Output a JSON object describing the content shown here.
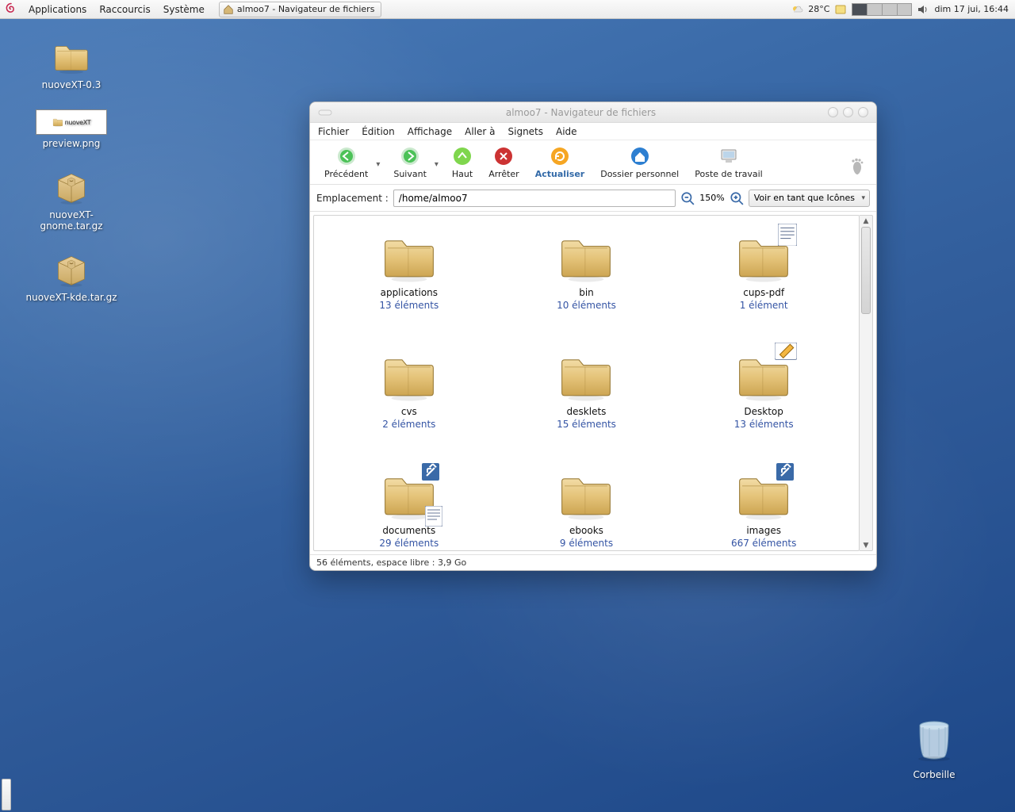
{
  "panel": {
    "menus": [
      "Applications",
      "Raccourcis",
      "Système"
    ],
    "taskbar_label": "almoo7 - Navigateur de fichiers",
    "weather": "28°C",
    "clock": "dim 17 jui, 16:44"
  },
  "desktop_icons": [
    {
      "name": "nuoveXT-0.3",
      "type": "folder"
    },
    {
      "name": "preview.png",
      "type": "image"
    },
    {
      "name": "nuoveXT-gnome.tar.gz",
      "type": "package"
    },
    {
      "name": "nuoveXT-kde.tar.gz",
      "type": "package"
    }
  ],
  "trash": {
    "label": "Corbeille"
  },
  "window": {
    "title": "almoo7 - Navigateur de fichiers",
    "menus": [
      "Fichier",
      "Édition",
      "Affichage",
      "Aller à",
      "Signets",
      "Aide"
    ],
    "toolbar": {
      "back": "Précédent",
      "forward": "Suivant",
      "up": "Haut",
      "stop": "Arrêter",
      "reload": "Actualiser",
      "home": "Dossier personnel",
      "computer": "Poste de travail"
    },
    "location_label": "Emplacement :",
    "location_value": "/home/almoo7",
    "zoom": "150%",
    "view_mode": "Voir en tant que Icônes",
    "items": [
      {
        "name": "applications",
        "meta": "13 éléments",
        "emblem": null
      },
      {
        "name": "bin",
        "meta": "10 éléments",
        "emblem": null
      },
      {
        "name": "cups-pdf",
        "meta": "1 élément",
        "emblem": "note"
      },
      {
        "name": "cvs",
        "meta": "2 éléments",
        "emblem": null
      },
      {
        "name": "desklets",
        "meta": "15 éléments",
        "emblem": null
      },
      {
        "name": "Desktop",
        "meta": "13 éléments",
        "emblem": "pencil"
      },
      {
        "name": "documents",
        "meta": "29 éléments",
        "emblem": "link-note"
      },
      {
        "name": "ebooks",
        "meta": "9 éléments",
        "emblem": null
      },
      {
        "name": "images",
        "meta": "667 éléments",
        "emblem": "link"
      }
    ],
    "status": "56 éléments, espace libre : 3,9 Go"
  }
}
